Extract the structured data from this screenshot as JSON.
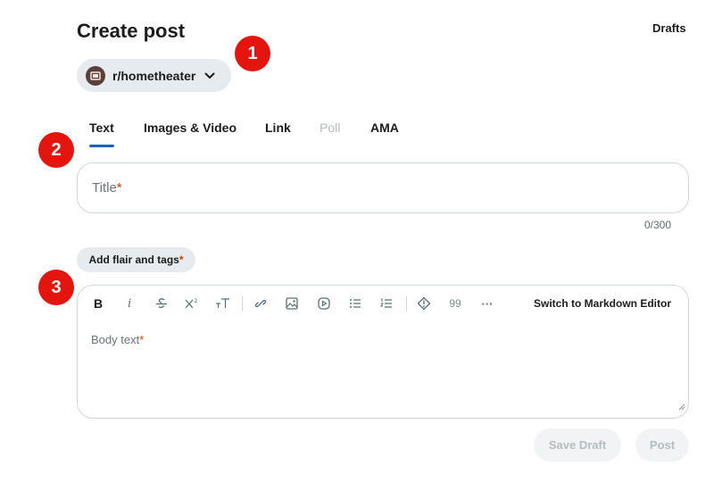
{
  "header": {
    "title": "Create post",
    "drafts_label": "Drafts"
  },
  "community": {
    "name": "r/hometheater",
    "icon": "community-avatar-icon"
  },
  "markers": [
    "1",
    "2",
    "3"
  ],
  "tabs": [
    {
      "label": "Text",
      "active": true
    },
    {
      "label": "Images & Video"
    },
    {
      "label": "Link"
    },
    {
      "label": "Poll",
      "disabled": true
    },
    {
      "label": "AMA"
    }
  ],
  "title_field": {
    "placeholder": "Title",
    "required_mark": "*",
    "char_count": "0/300"
  },
  "flair": {
    "label": "Add flair and tags",
    "required_mark": "*"
  },
  "editor": {
    "toolbar_icons": [
      "bold-icon",
      "italic-icon",
      "strikethrough-icon",
      "superscript-icon",
      "heading-icon",
      "link-icon",
      "image-icon",
      "video-icon",
      "bulleted-list-icon",
      "numbered-list-icon",
      "spoiler-icon",
      "quote-icon",
      "more-icon"
    ],
    "bold_glyph": "B",
    "italic_glyph": "i",
    "quote_glyph": "99",
    "more_glyph": "···",
    "markdown_switch": "Switch to Markdown Editor",
    "body_placeholder": "Body text",
    "required_mark": "*"
  },
  "actions": {
    "save_draft": "Save Draft",
    "post": "Post"
  },
  "colors": {
    "marker": "#e3150e",
    "tab_underline": "#1d5fbf",
    "required": "#d93a00",
    "pill_bg": "#e5ebee"
  }
}
